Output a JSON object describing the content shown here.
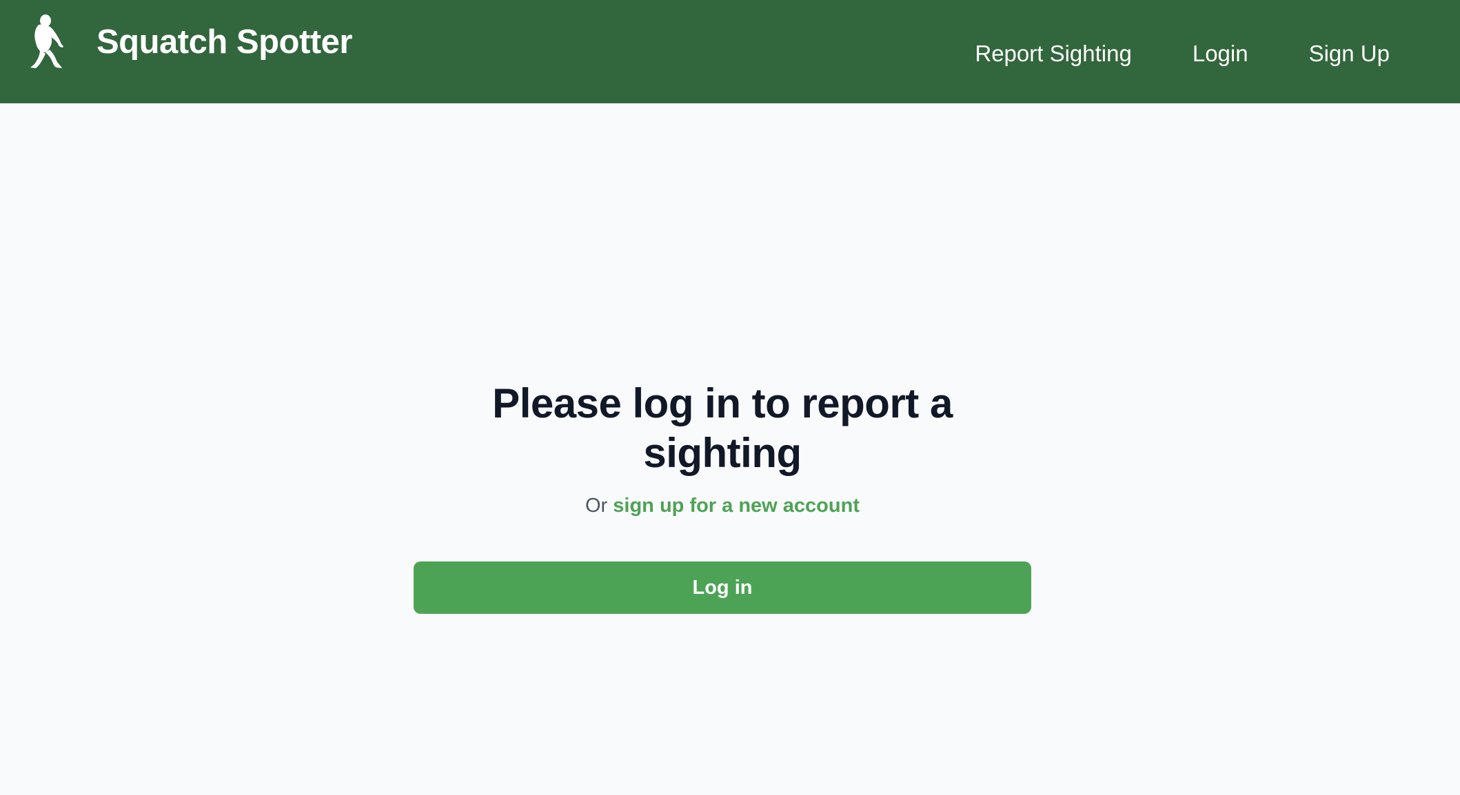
{
  "colors": {
    "navbar_bg": "#32663c",
    "page_bg": "#f9fafb",
    "accent": "#4da355",
    "heading": "#111827",
    "muted": "#4b5563"
  },
  "header": {
    "logo_icon": "bigfoot-icon",
    "brand_name": "Squatch Spotter",
    "nav": [
      {
        "label": "Report Sighting"
      },
      {
        "label": "Login"
      },
      {
        "label": "Sign Up"
      }
    ]
  },
  "main": {
    "heading": "Please log in to report a sighting",
    "subtext_prefix": "Or ",
    "signup_link": "sign up for a new account",
    "login_button": "Log in"
  }
}
